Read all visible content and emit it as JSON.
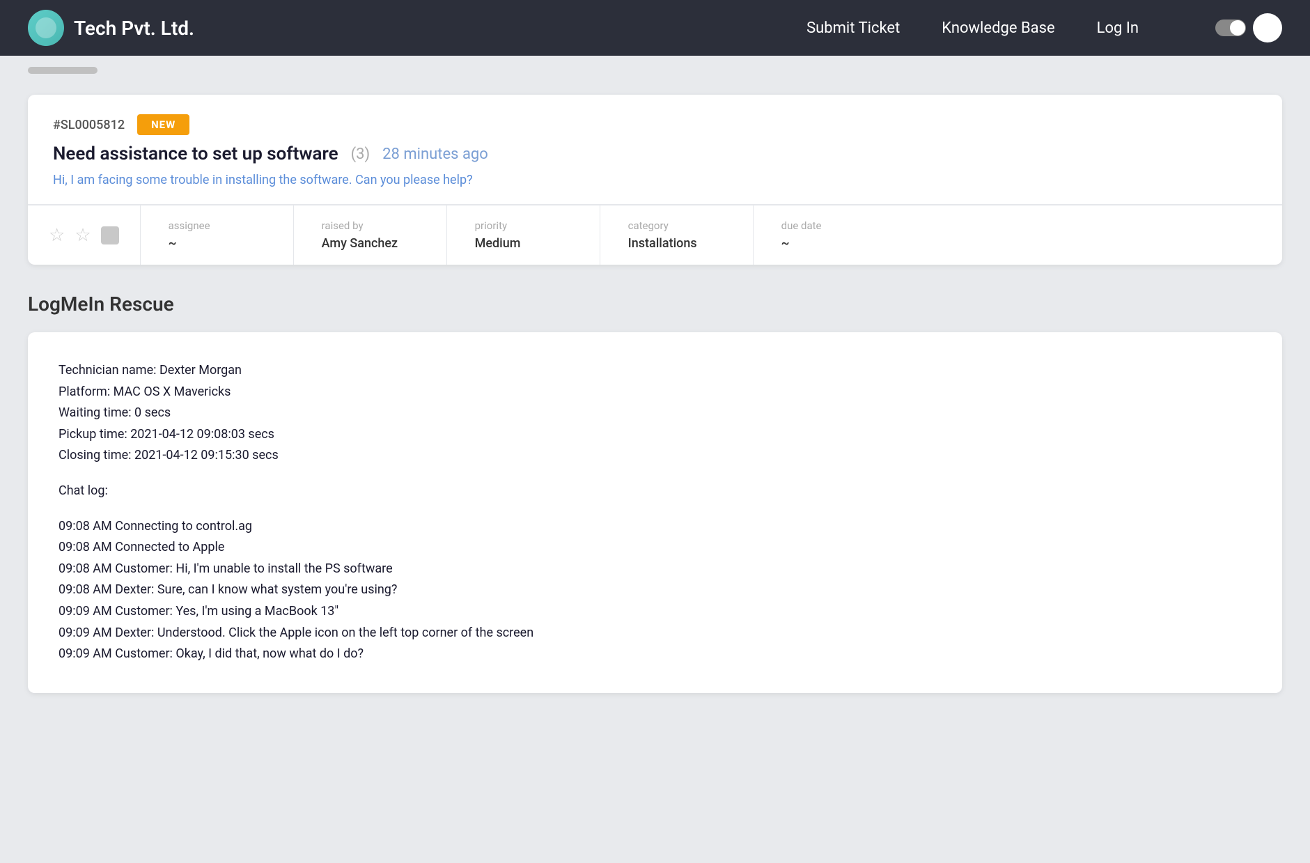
{
  "navbar": {
    "brand_name": "Tech Pvt. Ltd.",
    "submit_ticket_label": "Submit Ticket",
    "knowledge_base_label": "Knowledge Base",
    "login_label": "Log In"
  },
  "ticket": {
    "id": "#SL0005812",
    "status": "NEW",
    "title": "Need assistance to set up software",
    "comment_count": "(3)",
    "time_ago": "28 minutes ago",
    "preview": "Hi, I am facing some trouble in installing the software. Can you please help?",
    "meta": {
      "assignee_label": "assignee",
      "assignee_value": "~",
      "raised_by_label": "raised by",
      "raised_by_value": "Amy Sanchez",
      "priority_label": "priority",
      "priority_value": "Medium",
      "category_label": "category",
      "category_value": "Installations",
      "due_date_label": "due date",
      "due_date_value": "~"
    }
  },
  "section": {
    "title": "LogMeIn Rescue"
  },
  "log": {
    "lines": [
      "Technician name: Dexter Morgan",
      "Platform: MAC OS X Mavericks",
      "Waiting time: 0 secs",
      "Pickup time: 2021-04-12 09:08:03 secs",
      "Closing time: 2021-04-12 09:15:30 secs",
      "",
      "Chat log:",
      "",
      "09:08 AM Connecting to control.ag",
      "09:08 AM Connected to Apple",
      "09:08 AM Customer: Hi, I'm unable to install the PS software",
      "09:08 AM Dexter: Sure, can I know what system you're using?",
      "09:09 AM Customer: Yes, I'm using a MacBook 13\"",
      "09:09 AM Dexter: Understood. Click the Apple icon on the left top corner of the screen",
      "09:09 AM Customer: Okay, I did that, now what do I do?"
    ]
  }
}
